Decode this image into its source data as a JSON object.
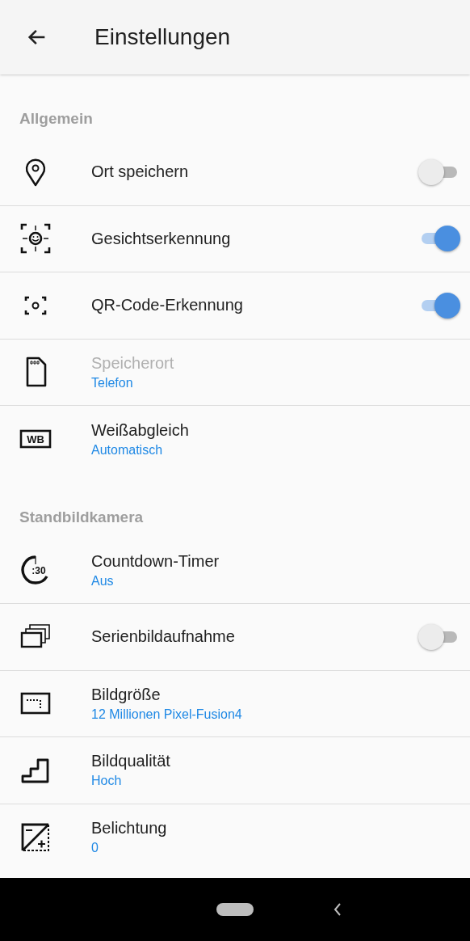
{
  "app_bar": {
    "title": "Einstellungen"
  },
  "sections": [
    {
      "title": "Allgemein",
      "items": [
        {
          "kind": "toggle",
          "title": "Ort speichern",
          "on": false,
          "disabled": false
        },
        {
          "kind": "toggle",
          "title": "Gesichtserkennung",
          "on": true,
          "disabled": false
        },
        {
          "kind": "toggle",
          "title": "QR-Code-Erkennung",
          "on": true,
          "disabled": false
        },
        {
          "kind": "value",
          "title": "Speicherort",
          "value": "Telefon",
          "disabled": true
        },
        {
          "kind": "value",
          "title": "Weißabgleich",
          "value": "Automatisch",
          "disabled": false,
          "icon_text": "WB"
        }
      ]
    },
    {
      "title": "Standbildkamera",
      "items": [
        {
          "kind": "value",
          "title": "Countdown-Timer",
          "value": "Aus",
          "disabled": false,
          "icon_text": ":30"
        },
        {
          "kind": "toggle",
          "title": "Serienbildaufnahme",
          "on": false,
          "disabled": false
        },
        {
          "kind": "value",
          "title": "Bildgröße",
          "value": "12 Millionen Pixel-Fusion4",
          "disabled": false
        },
        {
          "kind": "value",
          "title": "Bildqualität",
          "value": "Hoch",
          "disabled": false
        },
        {
          "kind": "value",
          "title": "Belichtung",
          "value": "0",
          "disabled": false
        }
      ]
    }
  ]
}
